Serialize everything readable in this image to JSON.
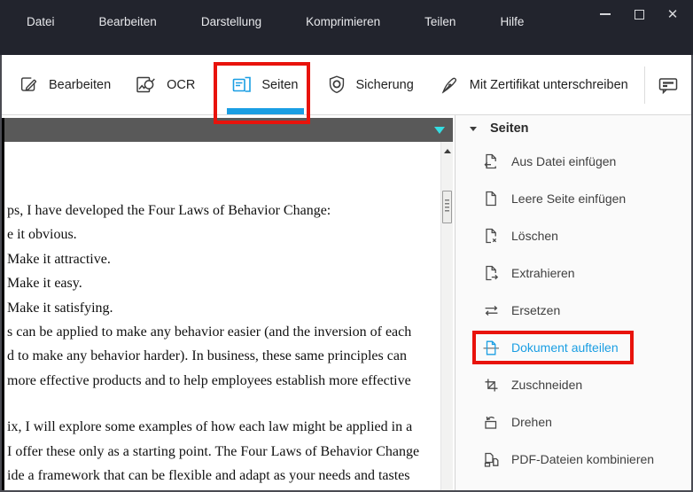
{
  "colors": {
    "titlebar_bg": "#22242d",
    "accent_blue": "#1a9ee3",
    "highlight_red": "#e8130c",
    "document_bar_gray": "#595959",
    "collapse_triangle_cyan": "#35dde2",
    "sidebar_bg": "#fafafa"
  },
  "titlebar": {
    "menu_items": [
      "Datei",
      "Bearbeiten",
      "Darstellung",
      "Komprimieren",
      "Teilen",
      "Hilfe"
    ]
  },
  "toolbar": {
    "items": [
      {
        "label": "Bearbeiten",
        "icon": "edit-icon"
      },
      {
        "label": "OCR",
        "icon": "ocr-icon"
      },
      {
        "label": "Seiten",
        "icon": "pages-icon",
        "active": true,
        "highlighted": true
      },
      {
        "label": "Sicherung",
        "icon": "shield-icon"
      },
      {
        "label": "Mit Zertifikat unterschreiben",
        "icon": "certificate-sign-icon"
      }
    ],
    "comment_tool_icon": "comment-icon"
  },
  "document": {
    "lines": [
      "ps, I have developed the Four Laws of Behavior Change:",
      "e it obvious.",
      "Make it attractive.",
      "Make it easy.",
      "Make it satisfying.",
      "s can be applied to make any behavior easier (and the inversion of each",
      "d to make any behavior harder). In business, these same principles can",
      "more effective products and to help employees establish more effective",
      "ix, I will explore some examples of how each law might be applied in a",
      "I offer these only as a starting point. The Four Laws of Behavior Change",
      "ide a framework that can be flexible and adapt as your needs and tastes"
    ]
  },
  "sidebar": {
    "title": "Seiten",
    "items": [
      {
        "label": "Aus Datei einfügen",
        "icon": "insert-from-file-icon"
      },
      {
        "label": "Leere Seite einfügen",
        "icon": "blank-page-icon"
      },
      {
        "label": "Löschen",
        "icon": "delete-page-icon"
      },
      {
        "label": "Extrahieren",
        "icon": "extract-page-icon"
      },
      {
        "label": "Ersetzen",
        "icon": "replace-page-icon"
      },
      {
        "label": "Dokument aufteilen",
        "icon": "split-document-icon",
        "highlighted": true
      },
      {
        "label": "Zuschneiden",
        "icon": "crop-icon"
      },
      {
        "label": "Drehen",
        "icon": "rotate-icon"
      },
      {
        "label": "PDF-Dateien kombinieren",
        "icon": "combine-pdf-icon"
      }
    ]
  }
}
